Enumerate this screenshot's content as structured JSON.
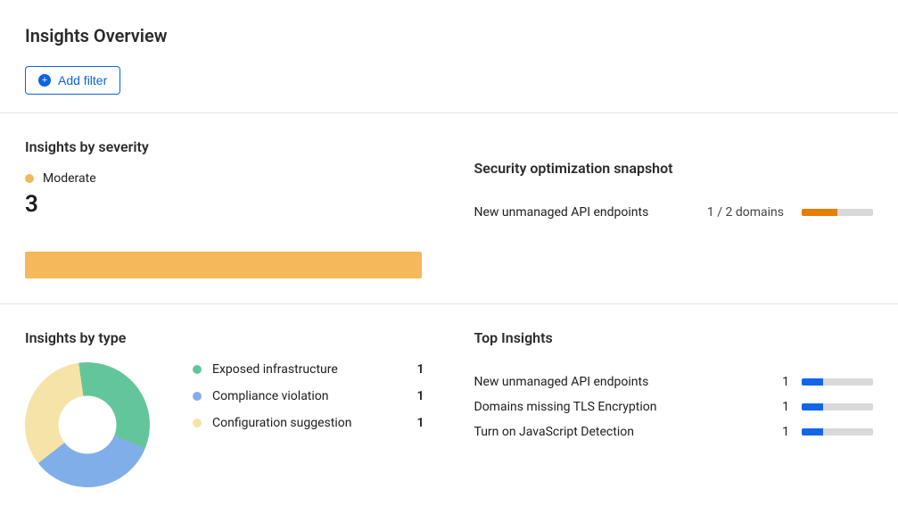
{
  "header": {
    "title": "Insights Overview",
    "add_filter_label": "Add filter"
  },
  "severity": {
    "title": "Insights by severity",
    "legend_label": "Moderate",
    "legend_color": "#F5B85A",
    "count": "3"
  },
  "optimization": {
    "title": "Security optimization snapshot",
    "rows": [
      {
        "label": "New unmanaged API endpoints",
        "count_text": "1 / 2 domains",
        "fill_pct": 50,
        "fill_color": "#E67E00"
      }
    ]
  },
  "by_type": {
    "title": "Insights by type",
    "items": [
      {
        "label": "Exposed infrastructure",
        "count": "1",
        "color": "#63C69B"
      },
      {
        "label": "Compliance violation",
        "count": "1",
        "color": "#80AEE8"
      },
      {
        "label": "Configuration suggestion",
        "count": "1",
        "color": "#F6E3A7"
      }
    ]
  },
  "top_insights": {
    "title": "Top Insights",
    "rows": [
      {
        "label": "New unmanaged API endpoints",
        "count": "1",
        "fill_pct": 30
      },
      {
        "label": "Domains missing TLS Encryption",
        "count": "1",
        "fill_pct": 30
      },
      {
        "label": "Turn on JavaScript Detection",
        "count": "1",
        "fill_pct": 30
      }
    ]
  },
  "chart_data": [
    {
      "type": "bar",
      "title": "Insights by severity",
      "categories": [
        "Moderate"
      ],
      "values": [
        3
      ]
    },
    {
      "type": "pie",
      "title": "Insights by type",
      "categories": [
        "Exposed infrastructure",
        "Compliance violation",
        "Configuration suggestion"
      ],
      "values": [
        1,
        1,
        1
      ]
    }
  ]
}
